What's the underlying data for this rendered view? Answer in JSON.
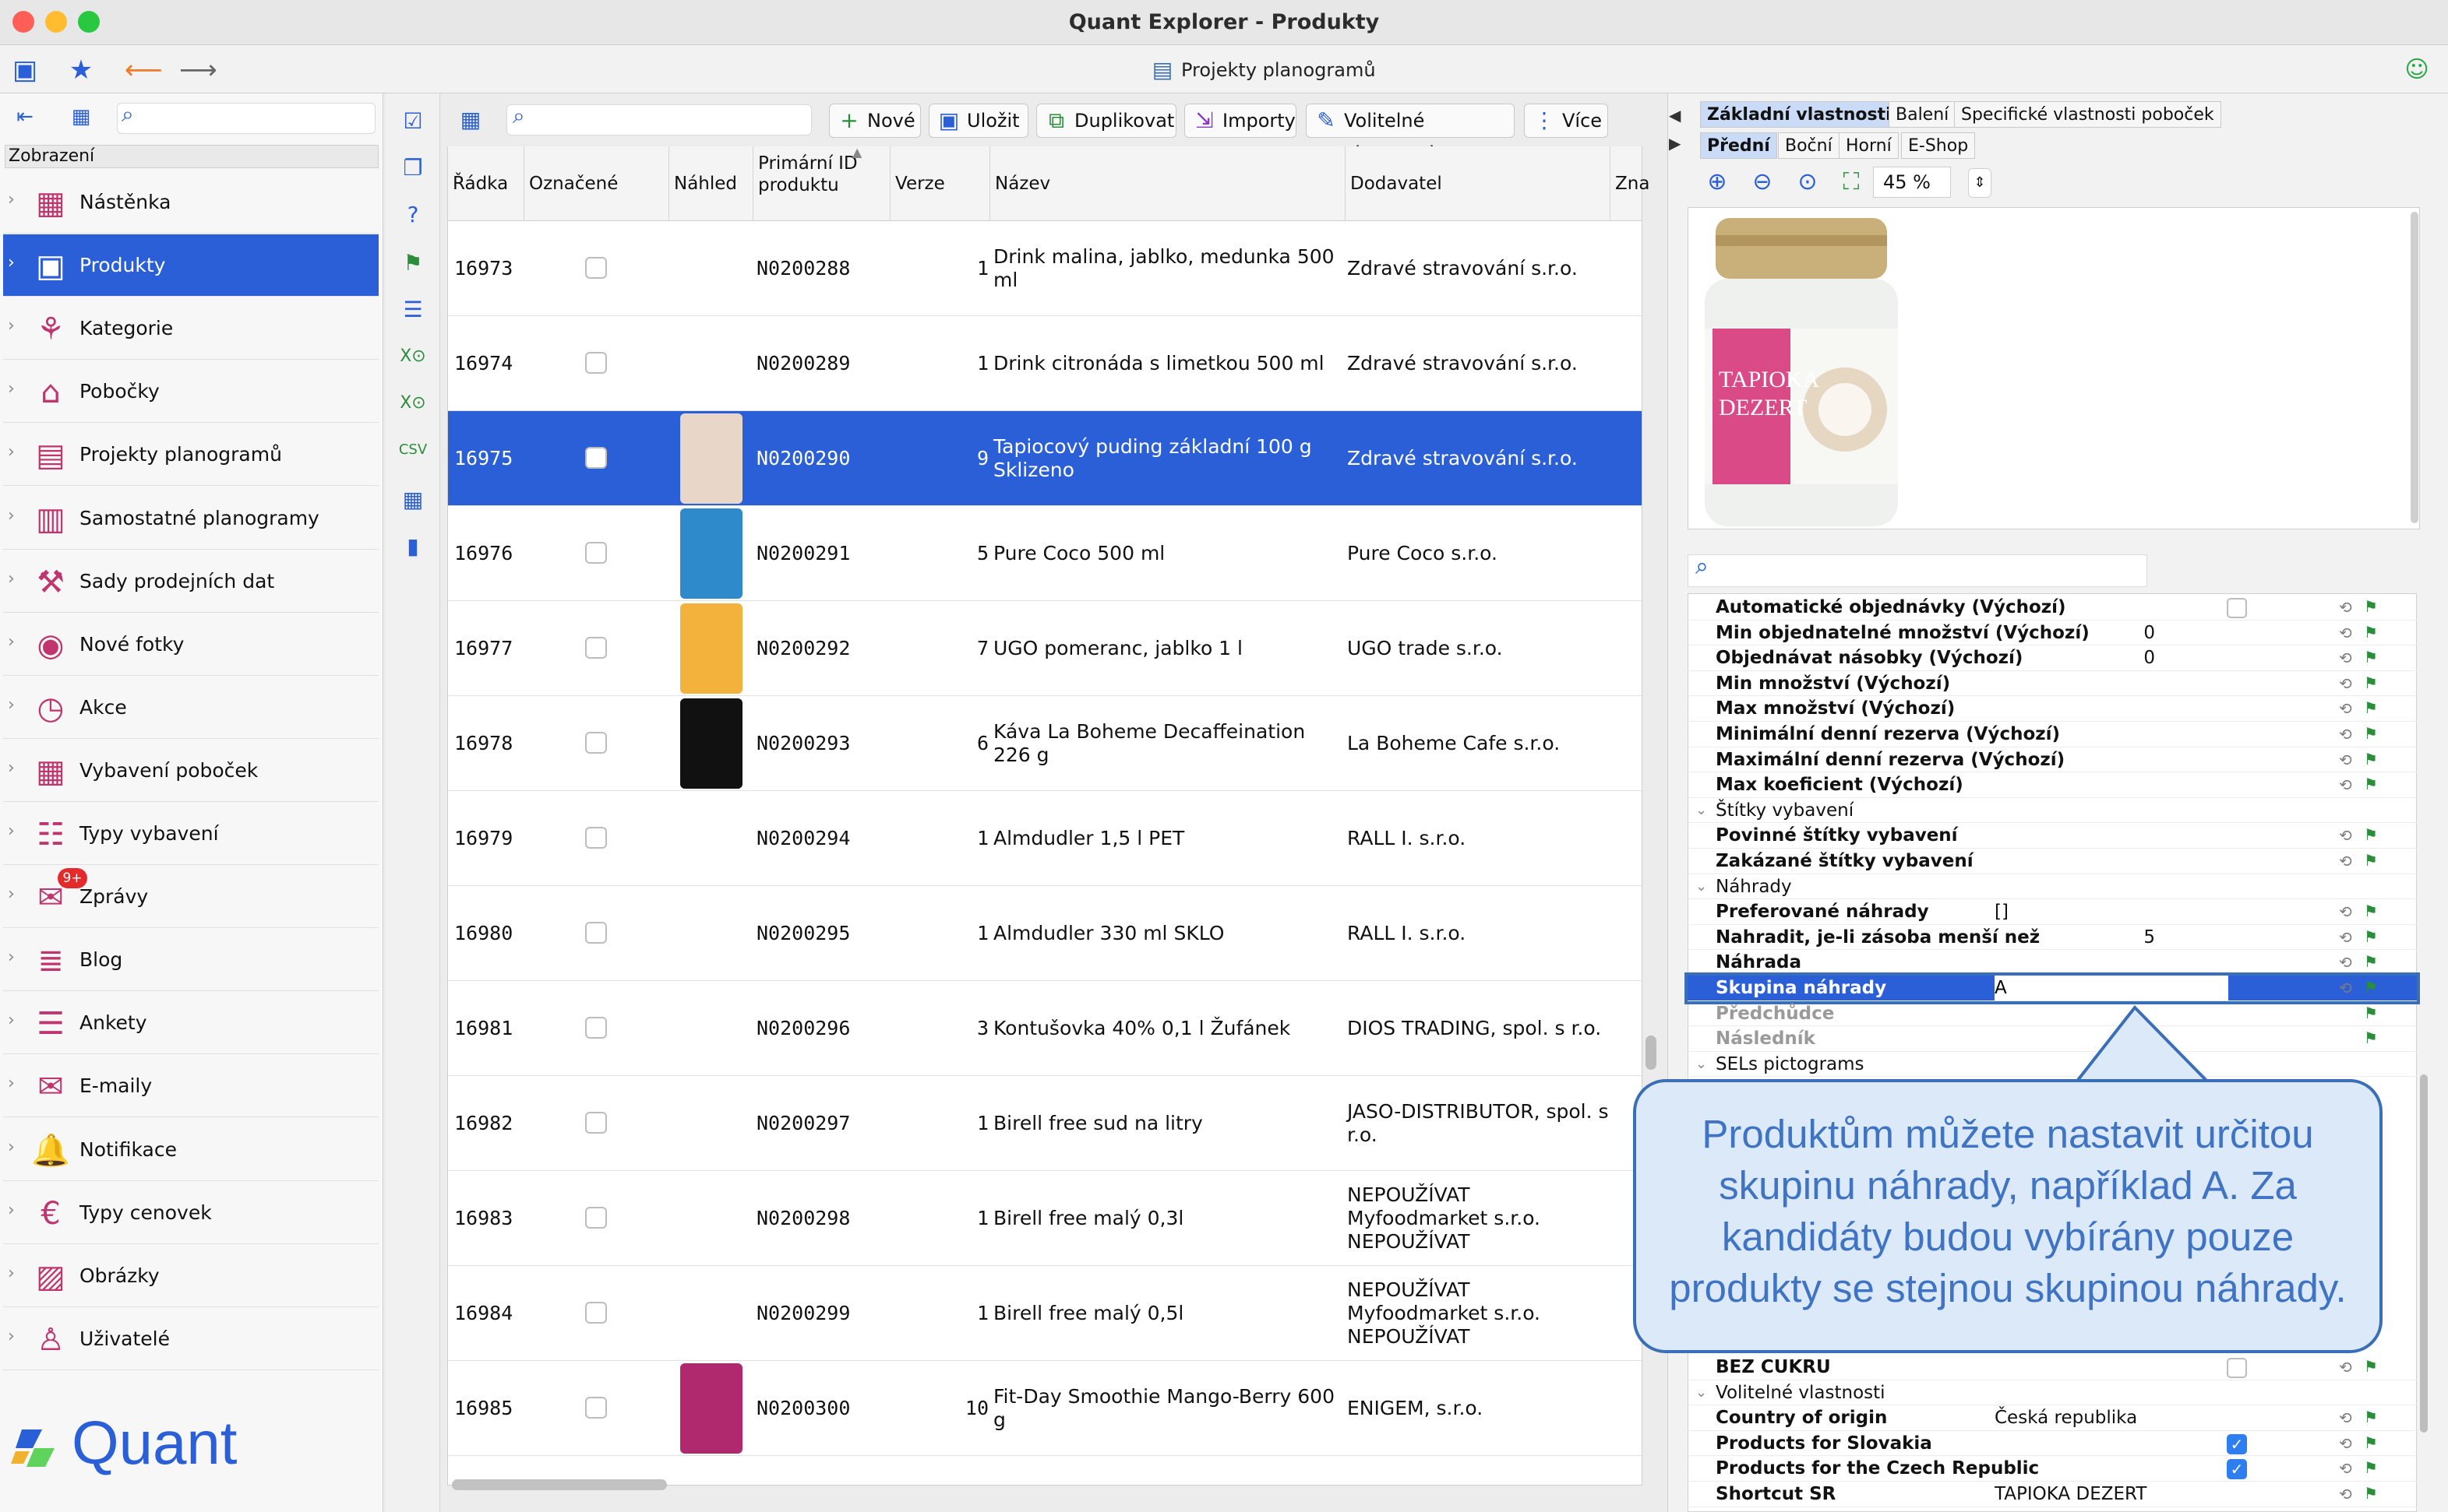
{
  "window": {
    "title": "Quant Explorer - Produkty"
  },
  "toolbar": {
    "breadcrumb": "Projekty planogramů"
  },
  "sidebar": {
    "header": "Zobrazení",
    "items": [
      {
        "label": "Nástěnka",
        "icon": "dashboard-icon"
      },
      {
        "label": "Produkty",
        "icon": "products-icon"
      },
      {
        "label": "Kategorie",
        "icon": "categories-icon"
      },
      {
        "label": "Pobočky",
        "icon": "branches-icon"
      },
      {
        "label": "Projekty planogramů",
        "icon": "planogram-projects-icon"
      },
      {
        "label": "Samostatné planogramy",
        "icon": "planograms-icon"
      },
      {
        "label": "Sady prodejních dat",
        "icon": "sales-data-icon"
      },
      {
        "label": "Nové fotky",
        "icon": "camera-icon"
      },
      {
        "label": "Akce",
        "icon": "promotions-icon"
      },
      {
        "label": "Vybavení poboček",
        "icon": "equipment-icon"
      },
      {
        "label": "Typy vybavení",
        "icon": "equipment-types-icon"
      },
      {
        "label": "Zprávy",
        "icon": "messages-icon"
      },
      {
        "label": "Blog",
        "icon": "blog-icon"
      },
      {
        "label": "Ankety",
        "icon": "surveys-icon"
      },
      {
        "label": "E-maily",
        "icon": "email-icon"
      },
      {
        "label": "Notifikace",
        "icon": "bell-icon"
      },
      {
        "label": "Typy cenovek",
        "icon": "price-tags-icon"
      },
      {
        "label": "Obrázky",
        "icon": "images-icon"
      },
      {
        "label": "Uživatelé",
        "icon": "users-icon"
      }
    ],
    "messages_badge": "9+",
    "logo_text": "Quant"
  },
  "table_toolbar": {
    "new": "Nové",
    "save": "Uložit",
    "duplicate": "Duplikovat",
    "imports": "Importy",
    "optional": "Volitelné vlastnosti",
    "more": "Více"
  },
  "columns": {
    "row": "Řádka",
    "marked": "Označené",
    "preview": "Náhled",
    "primary_id": "Primární ID produktu",
    "version": "Verze",
    "name": "Název",
    "supplier": "Dodavatel",
    "extra": "Zna"
  },
  "rows": [
    {
      "row": "16973",
      "id": "N0200288",
      "ver": "1",
      "name": "Drink malina, jablko, medunka 500 ml",
      "supplier": "Zdravé stravování s.r.o."
    },
    {
      "row": "16974",
      "id": "N0200289",
      "ver": "1",
      "name": "Drink citronáda s limetkou 500 ml",
      "supplier": "Zdravé stravování s.r.o."
    },
    {
      "row": "16975",
      "id": "N0200290",
      "ver": "9",
      "name": "Tapiocový puding základní 100 g Sklizeno",
      "supplier": "Zdravé stravování s.r.o."
    },
    {
      "row": "16976",
      "id": "N0200291",
      "ver": "5",
      "name": "Pure Coco 500 ml",
      "supplier": "Pure Coco s.r.o."
    },
    {
      "row": "16977",
      "id": "N0200292",
      "ver": "7",
      "name": "UGO pomeranc, jablko 1 l",
      "supplier": "UGO trade s.r.o."
    },
    {
      "row": "16978",
      "id": "N0200293",
      "ver": "6",
      "name": "Káva La Boheme Decaffeination 226 g",
      "supplier": "La Boheme Cafe s.r.o."
    },
    {
      "row": "16979",
      "id": "N0200294",
      "ver": "1",
      "name": "Almdudler 1,5 l PET",
      "supplier": "RALL I. s.r.o."
    },
    {
      "row": "16980",
      "id": "N0200295",
      "ver": "1",
      "name": "Almdudler 330 ml SKLO",
      "supplier": "RALL I. s.r.o."
    },
    {
      "row": "16981",
      "id": "N0200296",
      "ver": "3",
      "name": "Kontušovka 40% 0,1 l Žufánek",
      "supplier": "DIOS TRADING, spol. s r.o."
    },
    {
      "row": "16982",
      "id": "N0200297",
      "ver": "1",
      "name": "Birell free sud na litry",
      "supplier": "JASO-DISTRIBUTOR, spol. s r.o."
    },
    {
      "row": "16983",
      "id": "N0200298",
      "ver": "1",
      "name": "Birell free malý 0,3l",
      "supplier": "NEPOUŽÍVAT Myfoodmarket s.r.o. NEPOUŽÍVAT"
    },
    {
      "row": "16984",
      "id": "N0200299",
      "ver": "1",
      "name": "Birell free malý 0,5l",
      "supplier": "NEPOUŽÍVAT Myfoodmarket s.r.o. NEPOUŽÍVAT"
    },
    {
      "row": "16985",
      "id": "N0200300",
      "ver": "10",
      "name": "Fit-Day Smoothie Mango-Berry 600 g",
      "supplier": "ENIGEM, s.r.o."
    }
  ],
  "right_panel": {
    "tabs_top": [
      "Základní vlastnosti",
      "Balení",
      "Specifické vlastnosti poboček"
    ],
    "tabs_view": [
      "Přední",
      "Boční",
      "Horní",
      "E-Shop"
    ],
    "zoom": "45 %",
    "image_text": "TAPIOKA DEZERT",
    "properties": [
      {
        "label": "Automatické objednávky (Výchozí)",
        "type": "checkbox",
        "value": ""
      },
      {
        "label": "Min objednatelné množství (Výchozí)",
        "type": "num",
        "value": "0"
      },
      {
        "label": "Objednávat násobky (Výchozí)",
        "type": "num",
        "value": "0"
      },
      {
        "label": "Min množství (Výchozí)",
        "type": "text",
        "value": ""
      },
      {
        "label": "Max množství (Výchozí)",
        "type": "text",
        "value": ""
      },
      {
        "label": "Minimální denní rezerva (Výchozí)",
        "type": "text",
        "value": ""
      },
      {
        "label": "Maximální denní rezerva (Výchozí)",
        "type": "text",
        "value": ""
      },
      {
        "label": "Max koeficient (Výchozí)",
        "type": "text",
        "value": ""
      },
      {
        "label": "Štítky vybavení",
        "type": "group",
        "value": ""
      },
      {
        "label": "Povinné štítky vybavení",
        "type": "text",
        "value": ""
      },
      {
        "label": "Zakázané štítky vybavení",
        "type": "text",
        "value": ""
      },
      {
        "label": "Náhrady",
        "type": "group",
        "value": ""
      },
      {
        "label": "Preferované náhrady",
        "type": "text",
        "value": "[]"
      },
      {
        "label": "Nahradit, je-li zásoba menší než",
        "type": "num",
        "value": "5"
      },
      {
        "label": "Náhrada",
        "type": "text",
        "value": ""
      },
      {
        "label": "Skupina náhrady",
        "type": "selected",
        "value": "A"
      },
      {
        "label": "Předchůdce",
        "type": "dim",
        "value": ""
      },
      {
        "label": "Následník",
        "type": "dim",
        "value": ""
      },
      {
        "label": "SELs pictograms",
        "type": "group",
        "value": ""
      }
    ],
    "properties_bottom": [
      {
        "label": "BEZ CUKRU",
        "type": "checkbox",
        "value": ""
      },
      {
        "label": "Volitelné vlastnosti",
        "type": "group",
        "value": ""
      },
      {
        "label": "Country of origin",
        "type": "text",
        "value": "Česká republika"
      },
      {
        "label": "Products for Slovakia",
        "type": "checked",
        "value": ""
      },
      {
        "label": "Products for the Czech Republic",
        "type": "checked",
        "value": ""
      },
      {
        "label": "Shortcut SR",
        "type": "text",
        "value": "TAPIOKA DEZERT"
      }
    ]
  },
  "callout": {
    "text": "Produktům můžete nastavit určitou skupinu náhrady, například A. Za kandidáty budou vybírány pouze produkty se stejnou skupinou náhrady."
  }
}
